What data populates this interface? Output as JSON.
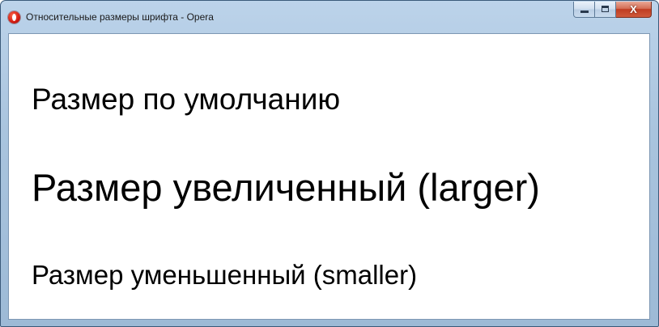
{
  "window": {
    "title": "Относительные размеры шрифта - Opera",
    "app_icon": "opera-icon",
    "caption_buttons": {
      "minimize_icon": "minimize-icon",
      "maximize_icon": "maximize-icon",
      "close_glyph": "X"
    }
  },
  "content": {
    "lines": [
      "Размер по умолчанию",
      "Размер увеличенный (larger)",
      "Размер уменьшенный (smaller)"
    ]
  },
  "colors": {
    "frame": "#a9c4de",
    "close_button": "#c03d22",
    "page_background": "#ffffff",
    "text": "#000000"
  }
}
